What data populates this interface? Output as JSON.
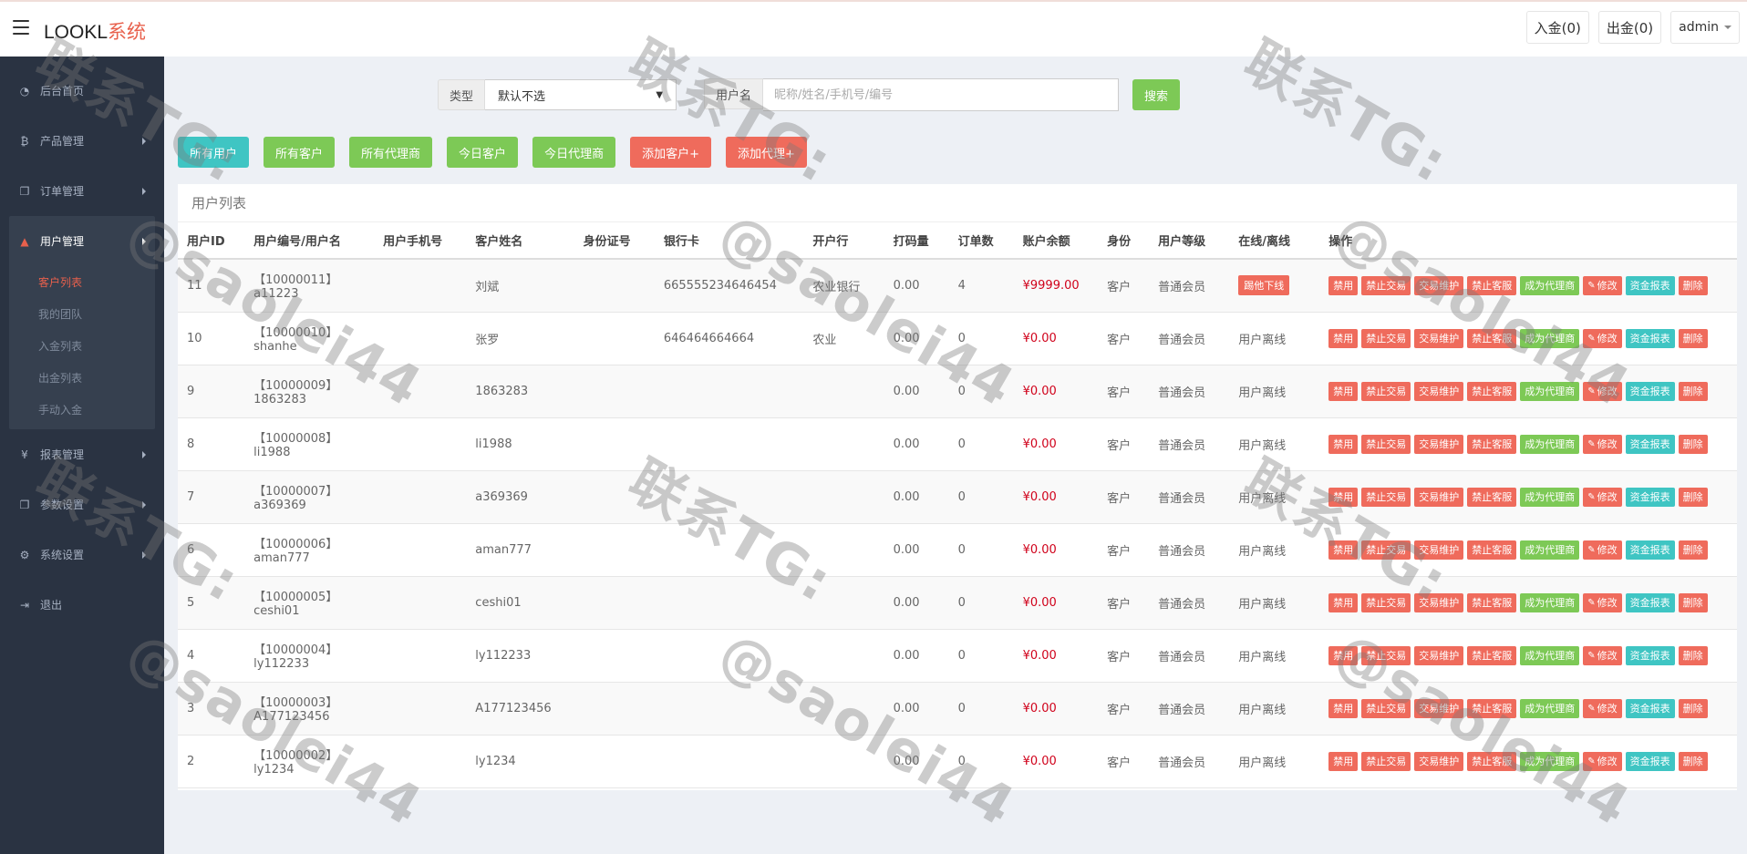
{
  "app": {
    "logo_prefix": "LOOKL",
    "logo_suffix": "系统"
  },
  "topbar": {
    "deposit_label": "入金(0)",
    "withdraw_label": "出金(0)",
    "admin_label": "admin"
  },
  "sidebar": {
    "items": [
      {
        "label": "后台首页",
        "icon": "dashboard-icon",
        "glyph": "◔"
      },
      {
        "label": "产品管理",
        "icon": "bitcoin-icon",
        "glyph": "₿"
      },
      {
        "label": "订单管理",
        "icon": "copy-icon",
        "glyph": "❐"
      },
      {
        "label": "用户管理",
        "icon": "user-icon",
        "glyph": "▲"
      },
      {
        "label": "报表管理",
        "icon": "yen-icon",
        "glyph": "¥"
      },
      {
        "label": "参数设置",
        "icon": "copy-icon",
        "glyph": "❐"
      },
      {
        "label": "系统设置",
        "icon": "cogs-icon",
        "glyph": "⚙"
      },
      {
        "label": "退出",
        "icon": "signout-icon",
        "glyph": "⇥"
      }
    ],
    "user_sub": [
      "客户列表",
      "我的团队",
      "入金列表",
      "出金列表",
      "手动入金"
    ]
  },
  "search": {
    "type_label": "类型",
    "type_value": "默认不选",
    "username_label": "用户名",
    "username_placeholder": "昵称/姓名/手机号/编号",
    "search_button": "搜索"
  },
  "filters": [
    "所有用户",
    "所有客户",
    "所有代理商",
    "今日客户",
    "今日代理商",
    "添加客户+",
    "添加代理+"
  ],
  "panel": {
    "title": "用户列表"
  },
  "table": {
    "headers": [
      "用户ID",
      "用户编号/用户名",
      "用户手机号",
      "客户姓名",
      "身份证号",
      "银行卡",
      "开户行",
      "打码量",
      "订单数",
      "账户余额",
      "身份",
      "用户等级",
      "在线/离线",
      "操作"
    ],
    "rows": [
      {
        "id": "11",
        "code": "【10000011】",
        "username": "a11223",
        "phone": "",
        "name": "刘斌",
        "idcard": "",
        "bank_card": "665555234646454",
        "bank": "农业银行",
        "bet": "0.00",
        "orders": "4",
        "balance": "¥9999.00",
        "role": "客户",
        "level": "普通会员",
        "status": "踢他下线"
      },
      {
        "id": "10",
        "code": "【10000010】",
        "username": "shanhe",
        "phone": "",
        "name": "张罗",
        "idcard": "",
        "bank_card": "646464664664",
        "bank": "农业",
        "bet": "0.00",
        "orders": "0",
        "balance": "¥0.00",
        "role": "客户",
        "level": "普通会员",
        "status": "用户离线"
      },
      {
        "id": "9",
        "code": "【10000009】",
        "username": "1863283",
        "phone": "",
        "name": "1863283",
        "idcard": "",
        "bank_card": "",
        "bank": "",
        "bet": "0.00",
        "orders": "0",
        "balance": "¥0.00",
        "role": "客户",
        "level": "普通会员",
        "status": "用户离线"
      },
      {
        "id": "8",
        "code": "【10000008】",
        "username": "li1988",
        "phone": "",
        "name": "li1988",
        "idcard": "",
        "bank_card": "",
        "bank": "",
        "bet": "0.00",
        "orders": "0",
        "balance": "¥0.00",
        "role": "客户",
        "level": "普通会员",
        "status": "用户离线"
      },
      {
        "id": "7",
        "code": "【10000007】",
        "username": "a369369",
        "phone": "",
        "name": "a369369",
        "idcard": "",
        "bank_card": "",
        "bank": "",
        "bet": "0.00",
        "orders": "0",
        "balance": "¥0.00",
        "role": "客户",
        "level": "普通会员",
        "status": "用户离线"
      },
      {
        "id": "6",
        "code": "【10000006】",
        "username": "aman777",
        "phone": "",
        "name": "aman777",
        "idcard": "",
        "bank_card": "",
        "bank": "",
        "bet": "0.00",
        "orders": "0",
        "balance": "¥0.00",
        "role": "客户",
        "level": "普通会员",
        "status": "用户离线"
      },
      {
        "id": "5",
        "code": "【10000005】",
        "username": "ceshi01",
        "phone": "",
        "name": "ceshi01",
        "idcard": "",
        "bank_card": "",
        "bank": "",
        "bet": "0.00",
        "orders": "0",
        "balance": "¥0.00",
        "role": "客户",
        "level": "普通会员",
        "status": "用户离线"
      },
      {
        "id": "4",
        "code": "【10000004】",
        "username": "ly112233",
        "phone": "",
        "name": "ly112233",
        "idcard": "",
        "bank_card": "",
        "bank": "",
        "bet": "0.00",
        "orders": "0",
        "balance": "¥0.00",
        "role": "客户",
        "level": "普通会员",
        "status": "用户离线"
      },
      {
        "id": "3",
        "code": "【10000003】",
        "username": "A177123456",
        "phone": "",
        "name": "A177123456",
        "idcard": "",
        "bank_card": "",
        "bank": "",
        "bet": "0.00",
        "orders": "0",
        "balance": "¥0.00",
        "role": "客户",
        "level": "普通会员",
        "status": "用户离线"
      },
      {
        "id": "2",
        "code": "【10000002】",
        "username": "ly1234",
        "phone": "",
        "name": "ly1234",
        "idcard": "",
        "bank_card": "",
        "bank": "",
        "bet": "0.00",
        "orders": "0",
        "balance": "¥0.00",
        "role": "客户",
        "level": "普通会员",
        "status": "用户离线"
      }
    ],
    "row_actions": [
      {
        "label": "禁用",
        "color": "red",
        "name": "disable-button"
      },
      {
        "label": "禁止交易",
        "color": "red",
        "name": "ban-trade-button"
      },
      {
        "label": "交易维护",
        "color": "red",
        "name": "trade-maintenance-button"
      },
      {
        "label": "禁止客服",
        "color": "red",
        "name": "ban-support-button"
      },
      {
        "label": "成为代理商",
        "color": "green",
        "name": "make-agent-button"
      },
      {
        "label": "修改",
        "color": "red",
        "name": "edit-button",
        "icon": "pencil-icon"
      },
      {
        "label": "资金报表",
        "color": "teal",
        "name": "fund-report-button"
      },
      {
        "label": "删除",
        "color": "red",
        "name": "delete-button"
      }
    ]
  },
  "watermark": {
    "line1": "联系TG:",
    "line2": "@saolei44"
  },
  "colors": {
    "sidebar_bg": "#2a3342",
    "accent_red": "#e8604c",
    "green": "#7dc956",
    "teal": "#3fc5c3",
    "money_red": "#d0021b"
  }
}
